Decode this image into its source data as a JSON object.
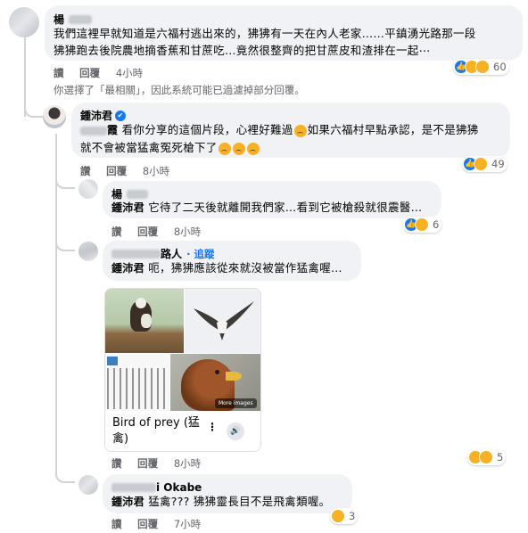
{
  "comments": [
    {
      "id": "c1",
      "name_visible": "楊",
      "text_line1": "我們這裡早就知道是六福村逃出來的，狒狒有一天在內人老家……平鎮湧光路那一段",
      "text_line2": "狒狒跑去後院農地摘香蕉和甘蔗吃…竟然很整齊的把甘蔗皮和渣排在一起⋯",
      "reply_label": "讀",
      "reply_action": "回覆",
      "time": "4小時",
      "reaction_count": "60",
      "notice": "你選擇了「最相關」，因此系統可能已過濾掉部分回覆。"
    },
    {
      "id": "c2",
      "name": "鍾沛君",
      "verified": "✔",
      "text_line1": "看你分享的這個片段，心裡好難過",
      "text_line1b": "如果六福村早點承認，是不是狒狒",
      "text_line2": "就不會被當猛禽冤死槍下了",
      "blur_prefix": "霞",
      "reply_label": "讚",
      "reply_action": "回覆",
      "time": "8小時",
      "reaction_count": "49"
    },
    {
      "id": "c3",
      "name_visible": "楊",
      "mention": "鍾沛君",
      "text": "它待了二天後就離開我們家…看到它被槍殺就很震醫…",
      "reply_label": "讚",
      "reply_action": "回覆",
      "time": "8小時",
      "reaction_count": "6"
    },
    {
      "id": "c4",
      "name_suffix": "路人",
      "follow": "· 追蹤",
      "mention": "鍾沛君",
      "text": "呃，狒狒應該從來就沒被當作猛禽喔…",
      "card_title": "Bird of prey (猛",
      "card_title2": "禽)",
      "more_images": "More images",
      "audio_icon": "speaker-icon",
      "reply_label": "讚",
      "reply_action": "回覆",
      "time": "8小時",
      "reaction_count": "5"
    },
    {
      "id": "c5",
      "name_suffix": "i Okabe",
      "mention": "鍾沛君",
      "text": "猛禽??? 狒狒靈長目不是飛禽類喔。",
      "reply_label": "讀",
      "reply_action": "回覆",
      "time": "7小時",
      "reaction_count": "3"
    }
  ],
  "colors": {
    "like_blue": "#1877f2",
    "emoji_yellow": "#f7b125",
    "bubble_gray": "#f0f2f5",
    "meta_gray": "#65676b"
  }
}
